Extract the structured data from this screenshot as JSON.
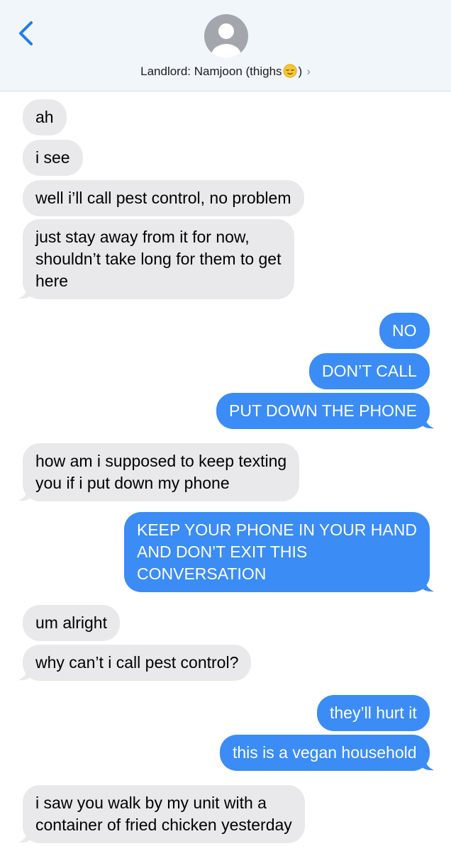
{
  "header": {
    "contact_name_prefix": "Landlord: Namjoon (thighs",
    "contact_name_suffix": ")",
    "emoji": "relieved-face",
    "back_icon": "chevron-left-icon",
    "details_icon": "chevron-right-icon"
  },
  "colors": {
    "incoming_bubble": "#e9e9eb",
    "outgoing_bubble": "#3b8cf5",
    "accent": "#1e7cf2"
  },
  "messages": [
    {
      "sender": "them",
      "lines": [
        "ah"
      ]
    },
    {
      "sender": "them",
      "lines": [
        "i see"
      ]
    },
    {
      "sender": "them",
      "lines": [
        "well i’ll call pest control, no problem"
      ]
    },
    {
      "sender": "them",
      "lines": [
        "just stay away from it for now,",
        "shouldn’t take long for them to get",
        "here"
      ]
    },
    {
      "sender": "me",
      "lines": [
        "NO"
      ]
    },
    {
      "sender": "me",
      "lines": [
        "DON’T CALL"
      ]
    },
    {
      "sender": "me",
      "lines": [
        "PUT DOWN THE PHONE"
      ]
    },
    {
      "sender": "them",
      "lines": [
        "how am i supposed to keep texting",
        "you if i put down my phone"
      ]
    },
    {
      "sender": "me",
      "lines": [
        "KEEP YOUR PHONE IN YOUR HAND",
        "AND DON’T EXIT THIS",
        "CONVERSATION"
      ]
    },
    {
      "sender": "them",
      "lines": [
        "um alright"
      ]
    },
    {
      "sender": "them",
      "lines": [
        "why can’t i call pest control?"
      ]
    },
    {
      "sender": "me",
      "lines": [
        "they’ll hurt it"
      ]
    },
    {
      "sender": "me",
      "lines": [
        "this is a vegan household"
      ]
    },
    {
      "sender": "them",
      "lines": [
        "i saw you walk by my unit with a",
        "container of fried chicken yesterday"
      ]
    }
  ]
}
